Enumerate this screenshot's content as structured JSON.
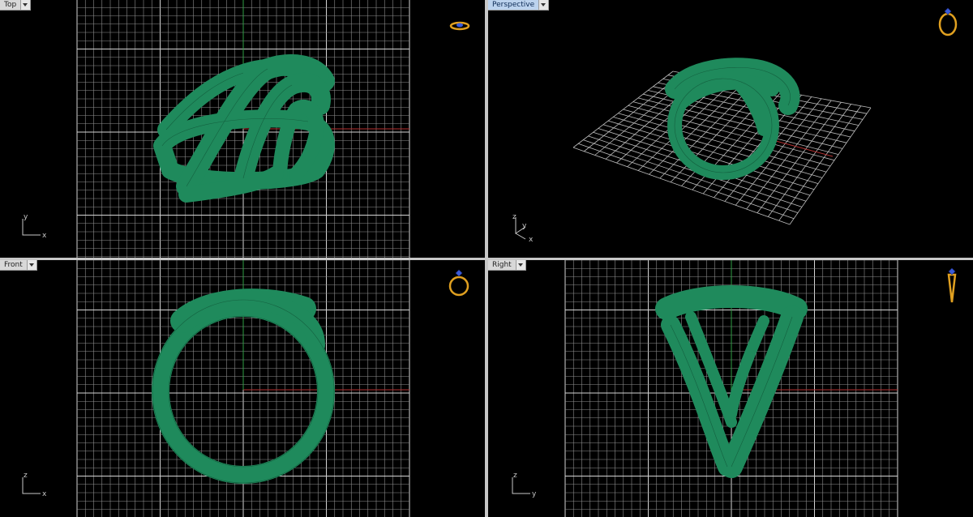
{
  "viewports": [
    {
      "id": "top",
      "title": "Top",
      "active": false,
      "axis_labels": {
        "vertical": "y",
        "horizontal": "x"
      }
    },
    {
      "id": "perspective",
      "title": "Perspective",
      "active": true,
      "axis_labels": {
        "vertical": "z",
        "depth": "y",
        "horizontal": "x"
      }
    },
    {
      "id": "front",
      "title": "Front",
      "active": false,
      "axis_labels": {
        "vertical": "z",
        "horizontal": "x"
      }
    },
    {
      "id": "right",
      "title": "Right",
      "active": false,
      "axis_labels": {
        "vertical": "z",
        "horizontal": "y"
      }
    }
  ],
  "colors": {
    "viewport_bg": "#000000",
    "grid": "#8e8e8e",
    "grid_major": "#d4d4d4",
    "x_axis": "#b33030",
    "y_axis": "#2f9e45",
    "model": "#1f8a5c",
    "model_wire": "#0f4f33",
    "nav_gold": "#e0a020",
    "nav_gem": "#3a5bd8",
    "separator": "#c7c7c7"
  },
  "icons": {
    "dropdown": "chevron-down-icon",
    "navigation": "ring-icon"
  }
}
